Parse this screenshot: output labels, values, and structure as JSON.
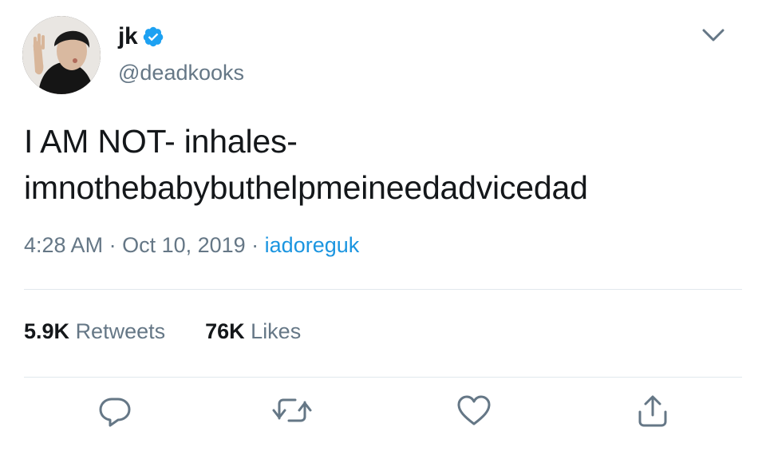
{
  "user": {
    "display_name": "jk",
    "handle": "@deadkooks",
    "verified": true,
    "avatar_icon": "avatar-photo"
  },
  "tweet": {
    "lines": [
      "I AM NOT- inhales-",
      "imnothebabybuthelpmeineedadvicedad"
    ]
  },
  "meta": {
    "time": "4:28 AM",
    "separator": " · ",
    "date": "Oct 10, 2019",
    "source": "iadoreguk"
  },
  "stats": {
    "retweets_count": "5.9K",
    "retweets_label": "Retweets",
    "likes_count": "76K",
    "likes_label": "Likes"
  },
  "icons": {
    "menu": "chevron-down-icon",
    "verified": "verified-badge-icon",
    "reply": "reply-icon",
    "retweet": "retweet-icon",
    "like": "heart-icon",
    "share": "share-icon"
  },
  "colors": {
    "text": "#14171a",
    "secondary": "#657786",
    "link": "#1b95e0",
    "verified": "#1da1f2",
    "divider": "#e1e8ed"
  }
}
